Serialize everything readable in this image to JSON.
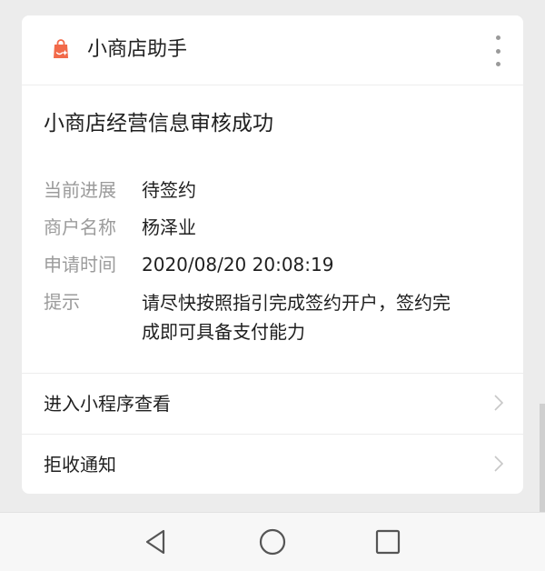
{
  "app": {
    "name": "小商店助手",
    "icon": "shopping-bag-icon",
    "accent_color": "#f26a4a"
  },
  "notice": {
    "title": "小商店经营信息审核成功",
    "fields": [
      {
        "label": "当前进展",
        "value": "待签约"
      },
      {
        "label": "商户名称",
        "value": "杨泽业"
      },
      {
        "label": "申请时间",
        "value": "2020/08/20 20:08:19"
      },
      {
        "label": "提示",
        "value_lines": [
          "请尽快按照指引完成签约开户，签约完",
          "成即可具备支付能力"
        ]
      }
    ]
  },
  "actions": [
    {
      "label": "进入小程序查看",
      "icon": "chevron-right-icon"
    },
    {
      "label": "拒收通知",
      "icon": "chevron-right-icon"
    }
  ],
  "navbar": {
    "buttons": [
      {
        "icon": "back-triangle-icon"
      },
      {
        "icon": "home-circle-icon"
      },
      {
        "icon": "recent-apps-square-icon"
      }
    ]
  }
}
